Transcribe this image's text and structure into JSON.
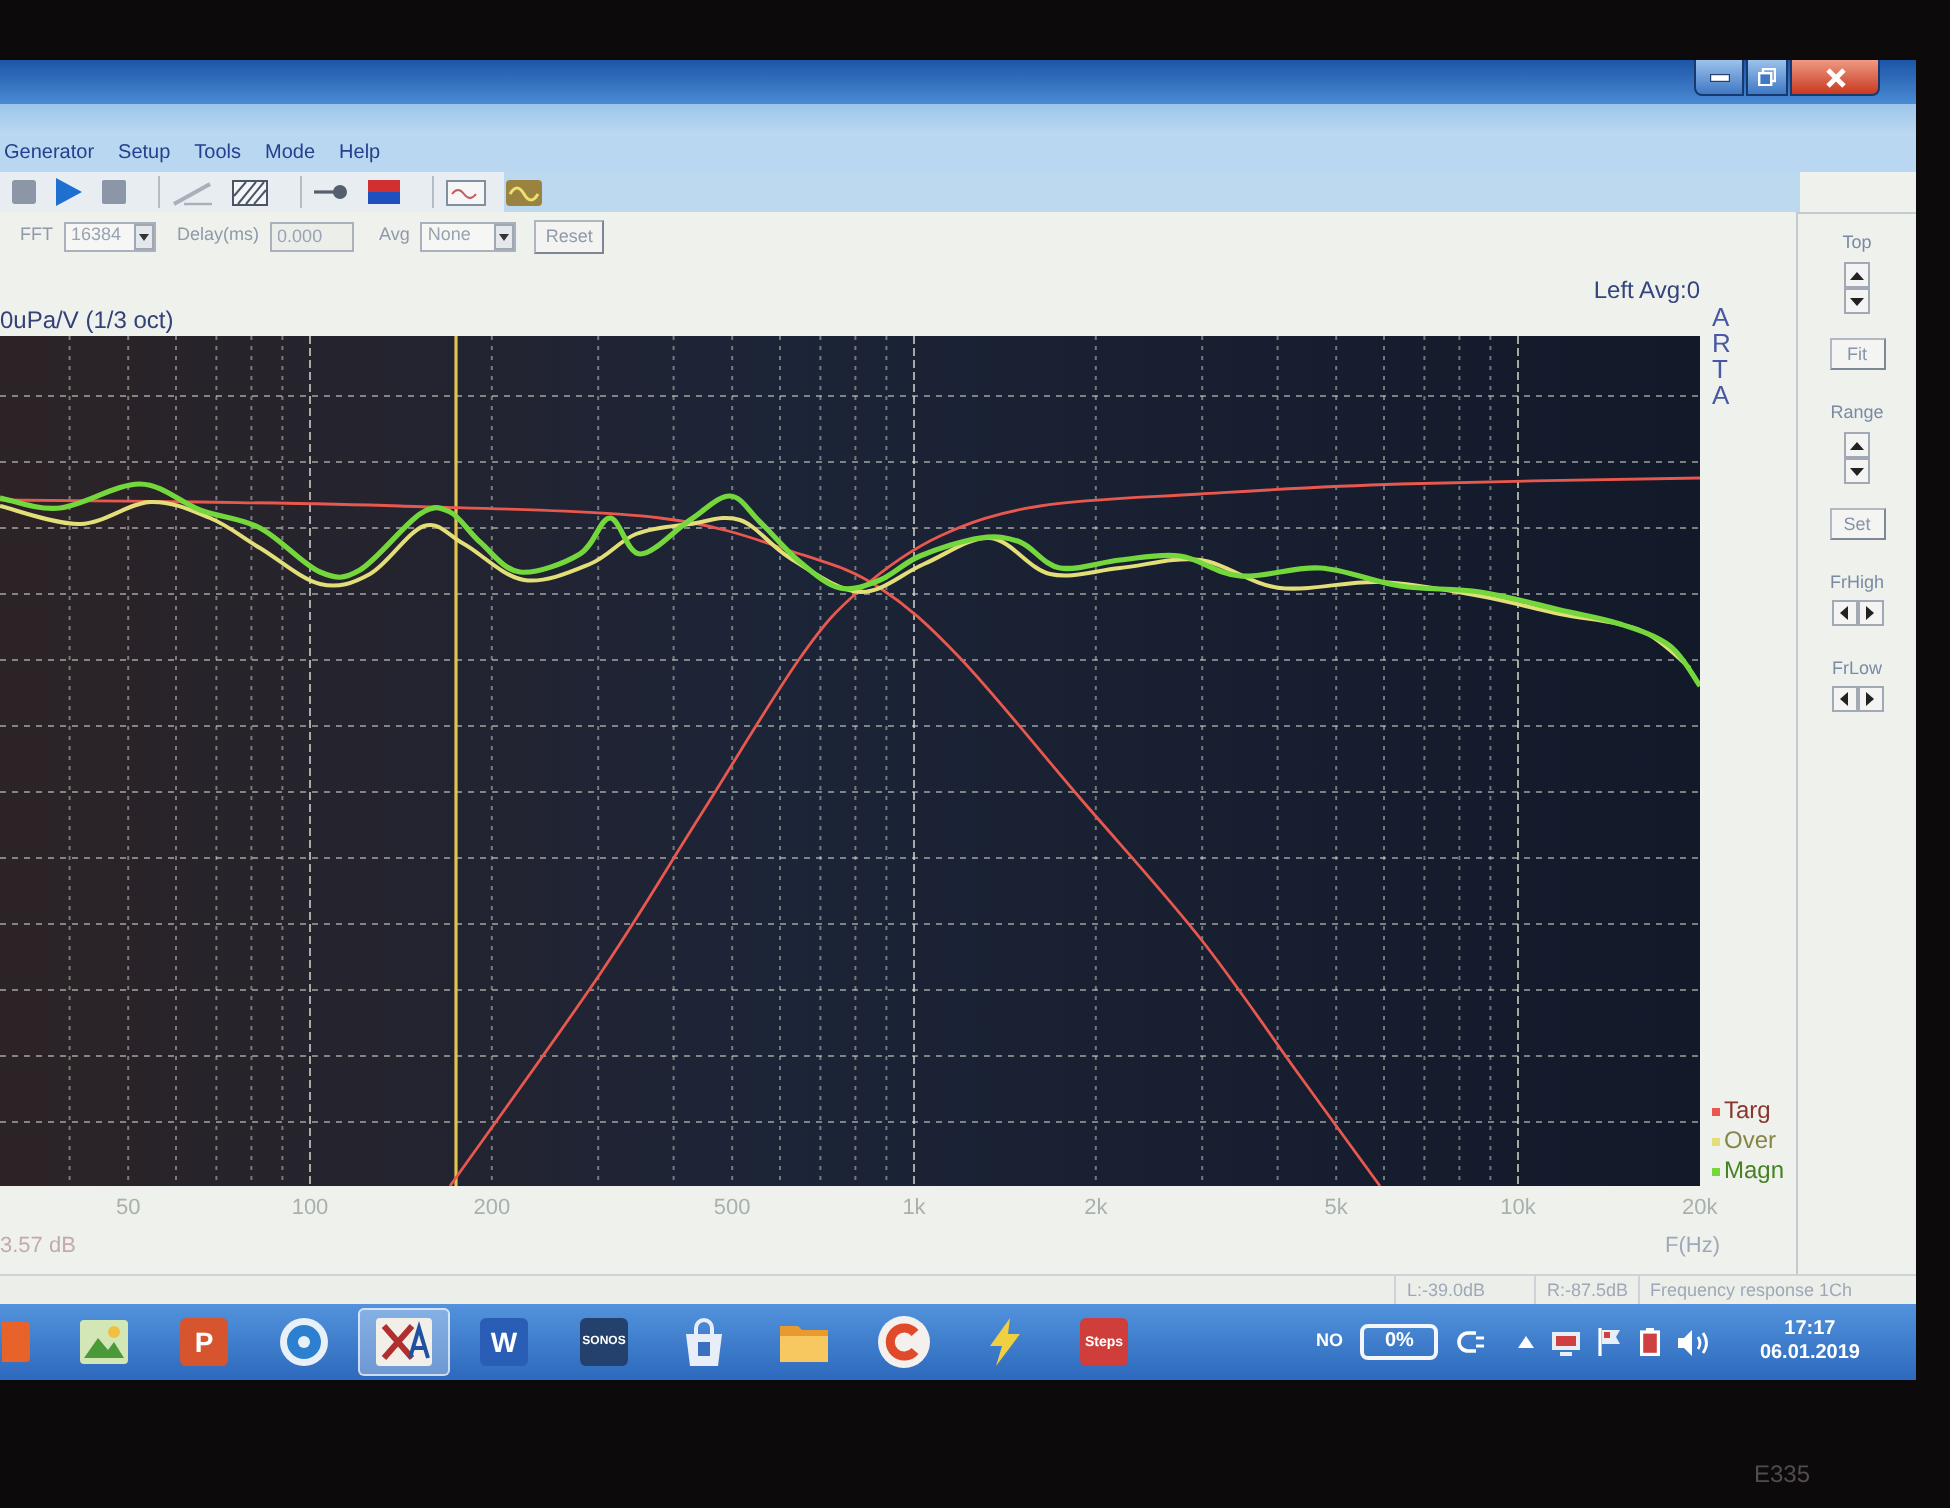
{
  "window": {
    "menu": [
      "Generator",
      "Setup",
      "Tools",
      "Mode",
      "Help"
    ]
  },
  "controls": {
    "fft": {
      "label": "FFT",
      "value": "16384"
    },
    "delay": {
      "label": "Delay(ms)",
      "value": "0.000"
    },
    "avg": {
      "label": "Avg",
      "value": "None"
    },
    "reset_button": "Reset"
  },
  "plot": {
    "channel_info": "Left Avg:0",
    "unit_label": "0uPa/V (1/3 oct)",
    "logo": "ARTA",
    "legend": [
      {
        "label": "Targ",
        "color": "#e8584e"
      },
      {
        "label": "Over",
        "color": "#e2de78"
      },
      {
        "label": "Magn",
        "color": "#74d83c"
      }
    ],
    "x_tick_labels": [
      "50",
      "100",
      "200",
      "500",
      "1k",
      "2k",
      "5k",
      "10k",
      "20k"
    ],
    "x_axis_title": "F(Hz)",
    "reading": "3.57 dB"
  },
  "side_panel": [
    {
      "kind": "label",
      "text": "Top"
    },
    {
      "kind": "spin"
    },
    {
      "kind": "button",
      "text": "Fit"
    },
    {
      "kind": "label",
      "text": "Range"
    },
    {
      "kind": "spin"
    },
    {
      "kind": "button",
      "text": "Set"
    },
    {
      "kind": "label",
      "text": "FrHigh"
    },
    {
      "kind": "stepper"
    },
    {
      "kind": "label",
      "text": "FrLow"
    },
    {
      "kind": "stepper"
    }
  ],
  "status_bar": [
    "L:-39.0dB",
    "R:-87.5dB",
    "Frequency response 1Ch"
  ],
  "taskbar": {
    "apps": [
      {
        "kind": "tiles",
        "selected": false
      },
      {
        "kind": "photo",
        "selected": false
      },
      {
        "kind": "slides",
        "label": "P",
        "selected": false
      },
      {
        "kind": "disc",
        "selected": false
      },
      {
        "kind": "cross",
        "selected": true
      },
      {
        "kind": "doc",
        "label": "W",
        "selected": false
      },
      {
        "kind": "speaker",
        "label": "SONOS",
        "selected": false
      },
      {
        "kind": "bag",
        "selected": false
      },
      {
        "kind": "folder",
        "selected": false
      },
      {
        "kind": "ring",
        "selected": false
      },
      {
        "kind": "bolt",
        "selected": false
      },
      {
        "kind": "steps",
        "label": "Steps",
        "selected": false
      }
    ],
    "tray": {
      "language": "NO",
      "battery": "0%",
      "time": "17:17",
      "date": "06.01.2019"
    }
  },
  "bezel_label": "E335"
}
